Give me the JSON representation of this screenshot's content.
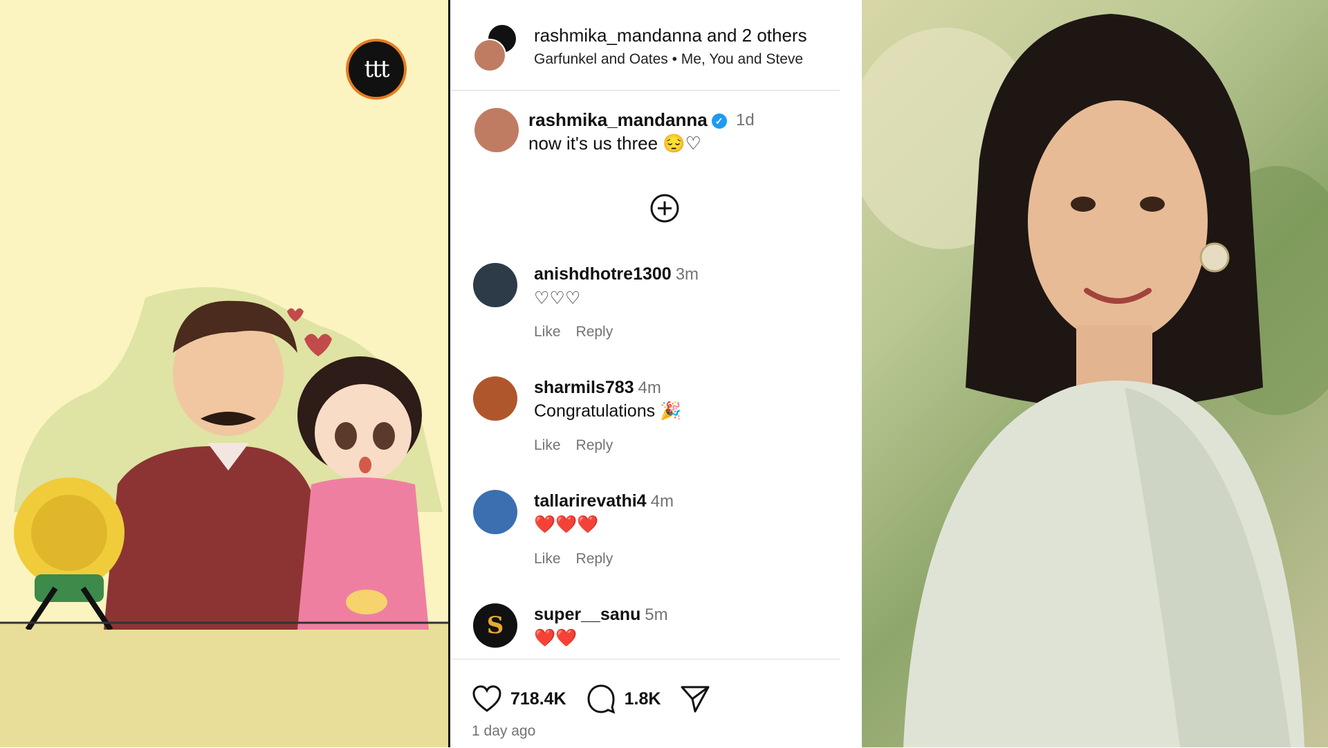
{
  "header": {
    "title": "rashmika_mandanna and 2 others",
    "audio": "Garfunkel and Oates • Me, You and Steve"
  },
  "post_logo": "ttt",
  "caption": {
    "username": "rashmika_mandanna",
    "verified_mark": "✓",
    "time": "1d",
    "text": "now it's us three 😔♡"
  },
  "comments": [
    {
      "username": "anishdhotre1300",
      "time": "3m",
      "text": "♡♡♡",
      "like": "Like",
      "reply": "Reply",
      "avatar_color": "#2d3b48"
    },
    {
      "username": "sharmils783",
      "time": "4m",
      "text": "Congratulations 🎉",
      "like": "Like",
      "reply": "Reply",
      "avatar_color": "#b0562c"
    },
    {
      "username": "tallarirevathi4",
      "time": "4m",
      "text": "❤️❤️❤️",
      "like": "Like",
      "reply": "Reply",
      "avatar_color": "#3a6fb0"
    },
    {
      "username": "super__sanu",
      "time": "5m",
      "text": "❤️❤️",
      "avatar_color": "#111111",
      "avatar_letter": "S"
    }
  ],
  "footer": {
    "likes": "718.4K",
    "comments": "1.8K",
    "posted": "1 day ago"
  },
  "colors": {
    "panel_bg": "#ffffff",
    "left_bg": "#fbf4c0",
    "verified": "#1d9bf0",
    "muted": "#737373",
    "logo_ring": "#e77b1f"
  }
}
